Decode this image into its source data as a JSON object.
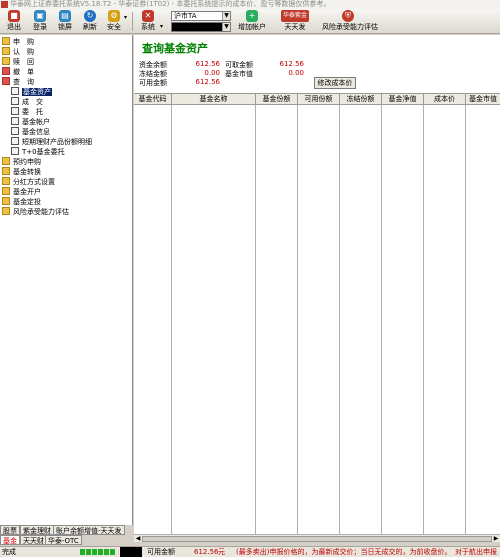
{
  "window": {
    "title": "华泰网上证券委托系统V5.18.T2 - 华泰证券(1T02) - 本委托系统提示的成本价、盈亏等数据仅供参考。"
  },
  "toolbar": {
    "buttons": [
      {
        "label": "退出",
        "icon": "exit-icon",
        "color": "#c0392b"
      },
      {
        "label": "登录",
        "icon": "login-icon",
        "color": "#2e86c1"
      },
      {
        "label": "锁屏",
        "icon": "lock-icon",
        "color": "#2e86c1"
      },
      {
        "label": "刷新",
        "icon": "refresh-icon",
        "color": "#1f6fc5"
      },
      {
        "label": "安全",
        "icon": "security-icon",
        "color": "#d4a017"
      },
      {
        "label": "系统",
        "icon": "tools-icon",
        "color": "#c0392b"
      }
    ],
    "account_type": "沪市TA",
    "account_number": "",
    "add_account_label": "增加帐户",
    "tiantianfa_label": "天天发",
    "tiantianfa_badge": "华泰紫金",
    "risk_label": "风险承受能力评估"
  },
  "tree": {
    "items": [
      {
        "label": "申　购",
        "icon": "folder",
        "level": 0
      },
      {
        "label": "认　购",
        "icon": "folder",
        "level": 0
      },
      {
        "label": "赎　回",
        "icon": "folder",
        "level": 0
      },
      {
        "label": "撤　单",
        "icon": "red",
        "level": 0
      },
      {
        "label": "查　询",
        "icon": "red",
        "level": 0
      },
      {
        "label": "基金资产",
        "icon": "doc",
        "level": 1,
        "selected": true
      },
      {
        "label": "成　交",
        "icon": "doc",
        "level": 1
      },
      {
        "label": "委　托",
        "icon": "doc",
        "level": 1
      },
      {
        "label": "基金帐户",
        "icon": "doc",
        "level": 1
      },
      {
        "label": "基金信息",
        "icon": "doc",
        "level": 1
      },
      {
        "label": "短期理财产品份额明细",
        "icon": "doc",
        "level": 1
      },
      {
        "label": "T+0基金委托",
        "icon": "doc",
        "level": 1
      },
      {
        "label": "预约申购",
        "icon": "folder",
        "level": 0
      },
      {
        "label": "基金转换",
        "icon": "folder",
        "level": 0
      },
      {
        "label": "分红方式设置",
        "icon": "folder",
        "level": 0
      },
      {
        "label": "基金开户",
        "icon": "folder",
        "level": 0
      },
      {
        "label": "基金定投",
        "icon": "folder",
        "level": 0
      },
      {
        "label": "风险承受能力评估",
        "icon": "folder",
        "level": 0
      }
    ],
    "tabs_row1": [
      "股票",
      "紫金理财",
      "账户余额增值-天天发"
    ],
    "tabs_row2": [
      "基金",
      "天天财",
      "华泰-OTC"
    ]
  },
  "main": {
    "title": "查询基金资产",
    "summary": {
      "fund_balance_label": "资金余额",
      "fund_balance": "612.56",
      "withdrawable_label": "可取金额",
      "withdrawable": "612.56",
      "frozen_label": "冻结金额",
      "frozen": "0.00",
      "market_value_label": "基金市值",
      "market_value": "0.00",
      "available_label": "可用金额",
      "available": "612.56"
    },
    "modify_cost_label": "修改成本价",
    "columns": [
      "基金代码",
      "基金名称",
      "基金份额",
      "可用份额",
      "冻结份额",
      "基金净值",
      "成本价",
      "基金市值"
    ]
  },
  "status": {
    "left": "完成",
    "available_label": "可用金额",
    "available_value": "612.56",
    "currency": "元",
    "notice": "(最多卖出)申报价格的，为最新成交价；当日无成交的，为前收盘价。",
    "notice2": "对于航出申报"
  }
}
